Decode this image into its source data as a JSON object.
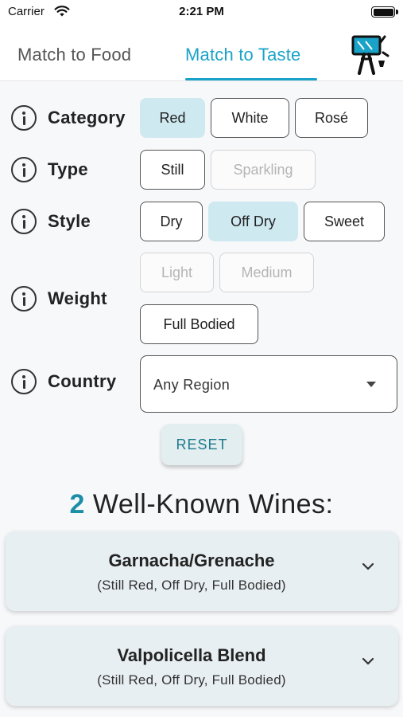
{
  "status_bar": {
    "carrier": "Carrier",
    "time": "2:21 PM"
  },
  "tabs": [
    {
      "label": "Match to Food",
      "active": false
    },
    {
      "label": "Match to Taste",
      "active": true
    }
  ],
  "filters": {
    "category": {
      "label": "Category",
      "options": [
        "Red",
        "White",
        "Rosé"
      ],
      "selected": "Red"
    },
    "type": {
      "label": "Type",
      "options": [
        "Still",
        "Sparkling"
      ],
      "disabled": [
        "Sparkling"
      ]
    },
    "style": {
      "label": "Style",
      "options": [
        "Dry",
        "Off Dry",
        "Sweet"
      ],
      "selected": "Off Dry"
    },
    "weight": {
      "label": "Weight",
      "options": [
        "Light",
        "Medium",
        "Full Bodied"
      ],
      "disabled": [
        "Light",
        "Medium"
      ]
    },
    "country": {
      "label": "Country",
      "value": "Any Region"
    }
  },
  "reset_label": "RESET",
  "results": {
    "count": "2",
    "heading": "Well-Known Wines:",
    "items": [
      {
        "name": "Garnacha/Grenache",
        "details": "(Still Red, Off Dry, Full Bodied)"
      },
      {
        "name": "Valpolicella Blend",
        "details": "(Still Red, Off Dry, Full Bodied)"
      }
    ]
  },
  "colors": {
    "accent": "#1aa3c8",
    "selected_chip": "#cfe9f1",
    "card": "#e8eff2"
  },
  "icons": [
    "wifi-icon",
    "battery-icon",
    "info-icon",
    "chevron-down-icon",
    "sommelier-logo-icon"
  ]
}
